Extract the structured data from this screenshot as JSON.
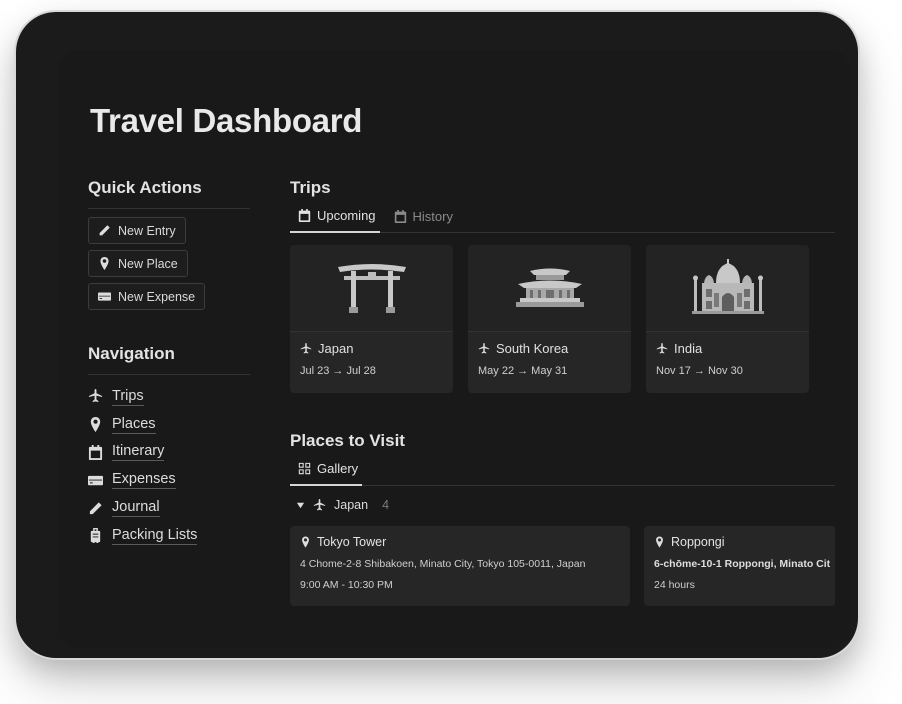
{
  "page": {
    "title": "Travel Dashboard"
  },
  "quick_actions": {
    "heading": "Quick Actions",
    "buttons": [
      {
        "label": "New Entry",
        "icon": "pencil-icon"
      },
      {
        "label": "New Place",
        "icon": "map-pin-icon"
      },
      {
        "label": "New Expense",
        "icon": "credit-card-icon"
      }
    ]
  },
  "navigation": {
    "heading": "Navigation",
    "items": [
      {
        "label": "Trips",
        "icon": "airplane-icon"
      },
      {
        "label": "Places",
        "icon": "map-pin-icon"
      },
      {
        "label": "Itinerary",
        "icon": "calendar-icon"
      },
      {
        "label": "Expenses",
        "icon": "credit-card-icon"
      },
      {
        "label": "Journal",
        "icon": "pencil-icon"
      },
      {
        "label": "Packing Lists",
        "icon": "luggage-icon"
      }
    ]
  },
  "trips": {
    "heading": "Trips",
    "tabs": [
      {
        "label": "Upcoming",
        "icon": "calendar-icon",
        "active": true
      },
      {
        "label": "History",
        "icon": "calendar-icon",
        "active": false
      }
    ],
    "cards": [
      {
        "name": "Japan",
        "dates": "Jul 23 → Jul 28",
        "image": "torii-gate"
      },
      {
        "name": "South Korea",
        "dates": "May 22 → May 31",
        "image": "korean-palace"
      },
      {
        "name": "India",
        "dates": "Nov 17 → Nov 30",
        "image": "taj-mahal"
      }
    ]
  },
  "places": {
    "heading": "Places to Visit",
    "tabs": [
      {
        "label": "Gallery",
        "icon": "gallery-grid-icon",
        "active": true
      }
    ],
    "group": {
      "label": "Japan",
      "count": "4"
    },
    "cards": [
      {
        "name": "Tokyo Tower",
        "address": "4 Chome-2-8 Shibakoen, Minato City, Tokyo 105-0011, Japan",
        "hours": "9:00 AM - 10:30 PM"
      },
      {
        "name": "Roppongi",
        "address": "6-chōme-10-1 Roppongi, Minato Cit",
        "hours": "24 hours"
      }
    ]
  }
}
